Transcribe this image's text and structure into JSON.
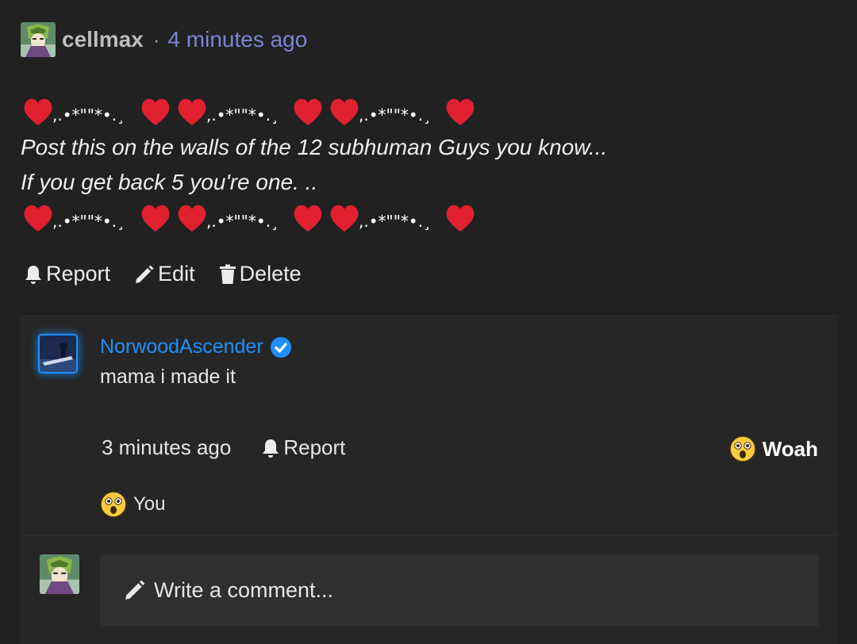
{
  "post": {
    "author": "cellmax",
    "separator": "·",
    "time": "4 minutes ago",
    "deco_segment": ",.•*\"\"*•.¸",
    "lines": [
      "Post this on the walls of the 12 subhuman Guys you know...",
      "If you get back 5 you're one. .."
    ],
    "actions": {
      "report": "Report",
      "edit": "Edit",
      "delete": "Delete"
    }
  },
  "comment": {
    "author": "NorwoodAscender",
    "text": "mama i made it",
    "time": "3 minutes ago",
    "report": "Report",
    "reaction_label": "Woah",
    "reactor": "You"
  },
  "composer": {
    "placeholder": "Write a comment..."
  },
  "colors": {
    "background": "#212121",
    "link": "#7b84d6",
    "verified": "#1e90ff",
    "heart": "#e0202e"
  }
}
